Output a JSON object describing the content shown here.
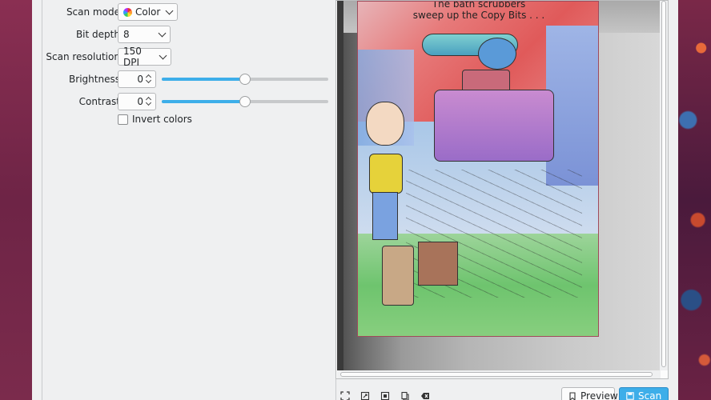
{
  "settings": {
    "scan_mode": {
      "label": "Scan mode:",
      "value": "Color"
    },
    "bit_depth": {
      "label": "Bit depth:",
      "value": "8"
    },
    "resolution": {
      "label": "Scan resolution:",
      "value": "150 DPI"
    },
    "brightness": {
      "label": "Brightness:",
      "value": "0",
      "level": 0.5
    },
    "contrast": {
      "label": "Contrast:",
      "value": "0",
      "level": 0.5
    },
    "invert_colors": {
      "label": "Invert colors",
      "checked": false
    }
  },
  "preview": {
    "caption_line1": "The bath scrubbers",
    "caption_line2": "sweep up the Copy Bits . . ."
  },
  "toolbar": {
    "icons": [
      "select-all-icon",
      "zoom-fit-icon",
      "zoom-selection-icon",
      "copy-selection-icon",
      "clear-selection-icon"
    ]
  },
  "actions": {
    "preview_label": "Preview",
    "scan_label": "Scan"
  },
  "colors": {
    "accent": "#3daee9",
    "window_bg": "#eff0f1"
  }
}
